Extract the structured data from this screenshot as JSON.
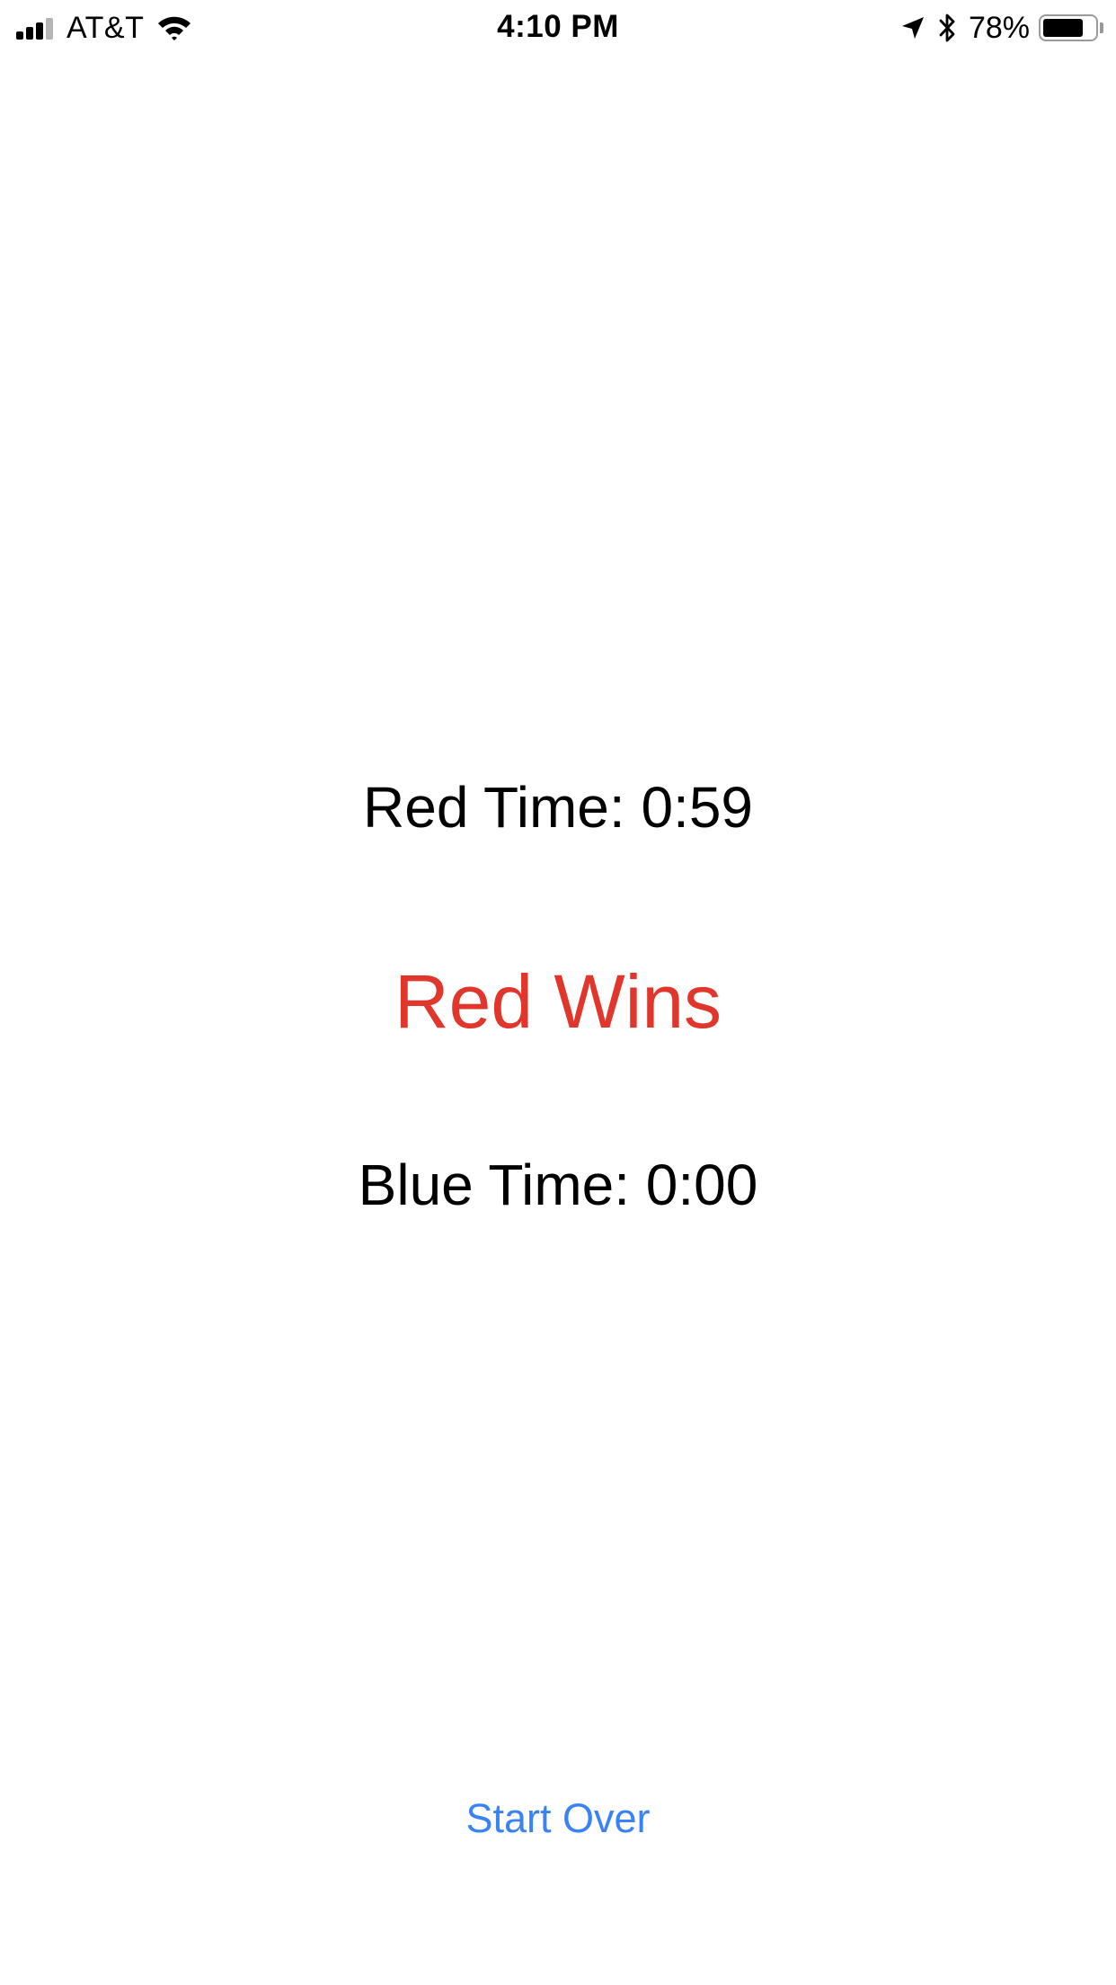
{
  "status_bar": {
    "carrier": "AT&T",
    "signal_bars_total": 4,
    "signal_bars_filled": 3,
    "signal_icon": "cellular-signal-icon",
    "wifi_icon": "wifi-icon",
    "time": "4:10 PM",
    "location_icon": "location-arrow-icon",
    "bluetooth_icon": "bluetooth-icon",
    "battery_percent": "78%",
    "battery_level": 0.78,
    "battery_icon": "battery-icon"
  },
  "game": {
    "red_time": "Red Time: 0:59",
    "result": "Red Wins",
    "blue_time": "Blue Time: 0:00"
  },
  "actions": {
    "start_over_label": "Start Over"
  },
  "colors": {
    "text": "#000000",
    "winner": "#e0362c",
    "link": "#3a82f7",
    "background": "#ffffff"
  }
}
